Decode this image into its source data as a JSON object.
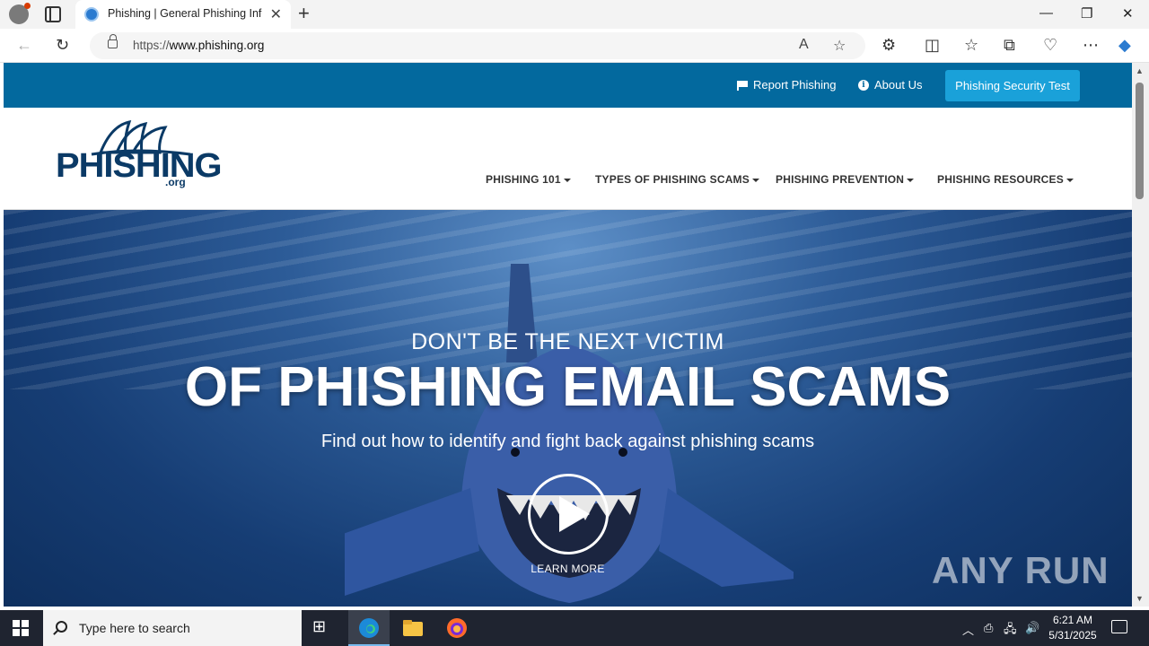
{
  "browser": {
    "tab_title": "Phishing | General Phishing Information",
    "new_tab": "+",
    "url_prefix": "https://",
    "url_domain": "www.phishing.org",
    "window_controls": {
      "minimize": "—",
      "restore": "❐",
      "close": "✕"
    }
  },
  "site": {
    "top_links": {
      "report": "Report Phishing",
      "about": "About Us",
      "cta": "Phishing Security Test"
    },
    "logo": {
      "name": "PHISHING",
      "tld": ".org"
    },
    "menu": [
      {
        "label": "PHISHING 101"
      },
      {
        "label": "TYPES OF PHISHING SCAMS"
      },
      {
        "label": "PHISHING PREVENTION"
      },
      {
        "label": "PHISHING RESOURCES"
      }
    ],
    "hero": {
      "kicker": "DON'T BE THE NEXT VICTIM",
      "title": "OF PHISHING EMAIL SCAMS",
      "subtitle": "Find out how to identify and fight back against phishing scams",
      "learn_more": "LEARN MORE",
      "watermark": "ANY RUN"
    },
    "colors": {
      "topbar": "#03699e",
      "cta": "#1aa1d9",
      "logo": "#0b3a66"
    }
  },
  "taskbar": {
    "search_placeholder": "Type here to search",
    "time": "6:21 AM",
    "date": "5/31/2025"
  }
}
